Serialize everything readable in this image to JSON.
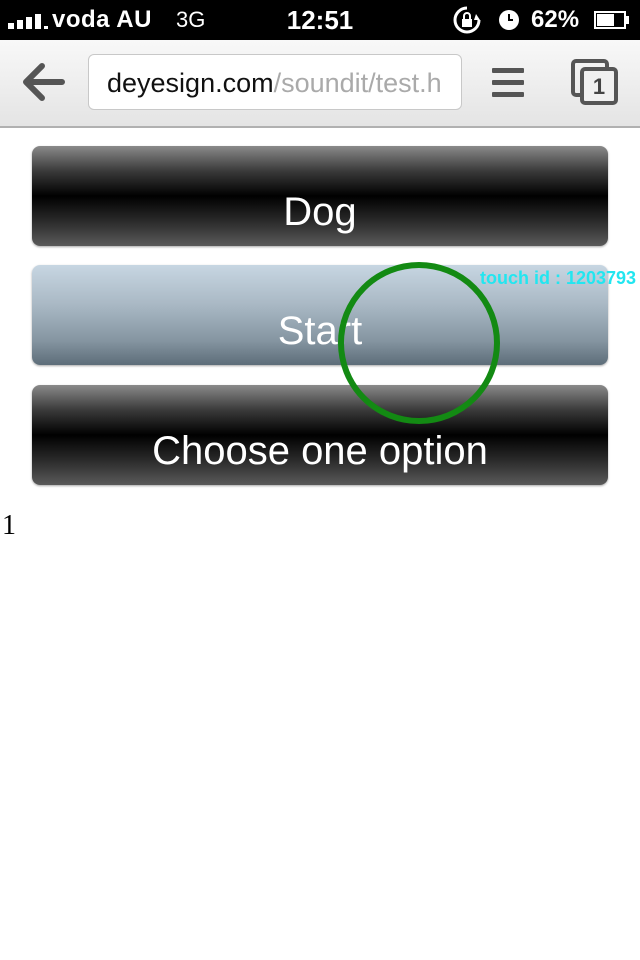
{
  "status_bar": {
    "carrier": "voda AU",
    "network": "3G",
    "time": "12:51",
    "battery_percent": "62%"
  },
  "browser": {
    "url_host": "deyesign.com",
    "url_path": "/soundit/test.h",
    "tab_count": "1"
  },
  "buttons": {
    "dog": "Dog",
    "start": "Start",
    "choose": "Choose one option"
  },
  "touch_overlay": {
    "label": "touch id : 1203793",
    "color": "#138a13",
    "label_color": "#22e6f0"
  },
  "counter": "1"
}
